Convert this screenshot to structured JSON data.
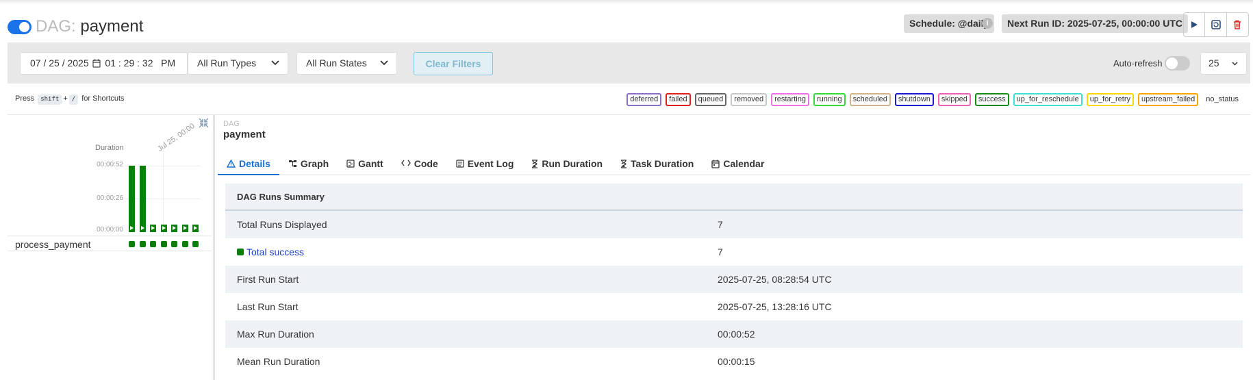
{
  "header": {
    "dag_prefix": "DAG:",
    "dag_name": "payment",
    "schedule": "Schedule: @daily",
    "next_run": "Next Run ID: 2025-07-25, 00:00:00 UTC",
    "info_glyph": "i"
  },
  "filters": {
    "date_value": "07 / 25 / 2025",
    "time_value": "01 : 29 : 32   PM",
    "run_types": "All Run Types",
    "run_states": "All Run States",
    "clear_label": "Clear Filters",
    "auto_refresh_label": "Auto-refresh",
    "auto_refresh_on": false,
    "num_runs": "25"
  },
  "shortcuts": {
    "press": "Press",
    "key1": "shift",
    "plus": "+",
    "key2": "/",
    "suffix": "for Shortcuts"
  },
  "legend": [
    {
      "label": "deferred",
      "color": "#8b6fc7"
    },
    {
      "label": "failed",
      "color": "#e0201f"
    },
    {
      "label": "queued",
      "color": "#666666"
    },
    {
      "label": "removed",
      "color": "#c8c8c8"
    },
    {
      "label": "restarting",
      "color": "#ee6ee6"
    },
    {
      "label": "running",
      "color": "#33dd33"
    },
    {
      "label": "scheduled",
      "color": "#d2b48c"
    },
    {
      "label": "shutdown",
      "color": "#1a1acc"
    },
    {
      "label": "skipped",
      "color": "#f060b0"
    },
    {
      "label": "success",
      "color": "#1a8a1a"
    },
    {
      "label": "up_for_reschedule",
      "color": "#40e0d0"
    },
    {
      "label": "up_for_retry",
      "color": "#ffd700"
    },
    {
      "label": "upstream_failed",
      "color": "#ffa500"
    },
    {
      "label": "no_status",
      "color": "transparent"
    }
  ],
  "grid": {
    "duration_label": "Duration",
    "date_label": "Jul 25, 00:00",
    "ticks": [
      "00:00:52",
      "00:00:26",
      "00:00:00"
    ],
    "run_durations_sec": [
      52,
      52,
      4,
      4,
      4,
      4,
      4
    ],
    "max_sec": 52,
    "task_name": "process_payment",
    "task_states": [
      "success",
      "success",
      "success",
      "success",
      "success",
      "success",
      "success"
    ],
    "success_color": "#0a800a"
  },
  "content": {
    "dag_label": "DAG",
    "dag_name": "payment",
    "tabs": [
      "Details",
      "Graph",
      "Gantt",
      "Code",
      "Event Log",
      "Run Duration",
      "Task Duration",
      "Calendar"
    ],
    "summary_title": "DAG Runs Summary",
    "rows": [
      {
        "key": "Total Runs Displayed",
        "value": "7"
      },
      {
        "key": "Total success",
        "value": "7"
      },
      {
        "key": "First Run Start",
        "value": "2025-07-25, 08:28:54 UTC"
      },
      {
        "key": "Last Run Start",
        "value": "2025-07-25, 13:28:16 UTC"
      },
      {
        "key": "Max Run Duration",
        "value": "00:00:52"
      },
      {
        "key": "Mean Run Duration",
        "value": "00:00:15"
      }
    ]
  },
  "icons": [
    "toggle-icon",
    "info-icon",
    "play-icon",
    "refresh-icon",
    "trash-icon",
    "calendar-icon",
    "chevron-down-icon",
    "collapse-icon",
    "warning-icon",
    "graph-icon",
    "gantt-icon",
    "code-icon",
    "event-log-icon",
    "hourglass-icon",
    "calendar-tab-icon"
  ]
}
